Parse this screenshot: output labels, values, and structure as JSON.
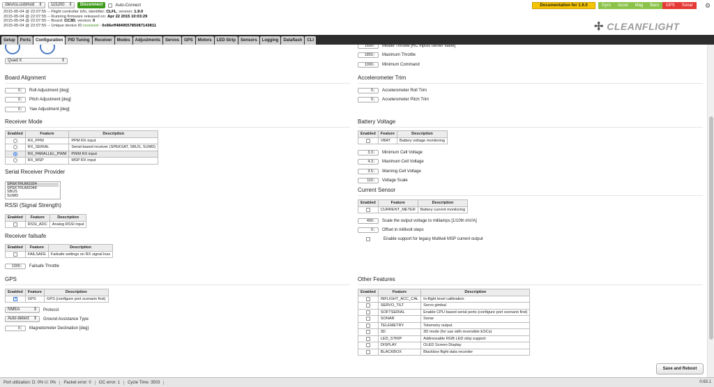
{
  "header": {
    "port": "/dev/cu.usbmod",
    "baud": "115200",
    "disconnect": "Disconnect",
    "autoconnect": "Auto-Connect",
    "documentation": "Documentation for 1.9.0",
    "sensors": [
      {
        "label": "Gyro",
        "color": "#8bc34a"
      },
      {
        "label": "Accel",
        "color": "#8bc34a"
      },
      {
        "label": "Mag",
        "color": "#8bc34a"
      },
      {
        "label": "Baro",
        "color": "#8bc34a"
      },
      {
        "label": "GPS",
        "color": "#e53935"
      },
      {
        "label": "Sonar",
        "color": "#e53935"
      }
    ],
    "logo": "CLEANFLIGHT"
  },
  "log": [
    {
      "pre": "2015-05-04 @ 22:07:55 -- Flight controller info, identifier: ",
      "b": "CLFL",
      "post": ", version: ",
      "b2": "1.9.0"
    },
    {
      "pre": "2015-05-04 @ 22:07:55 -- Running firmware released on: ",
      "b": "Apr 22 2015 10:03:29",
      "post": "",
      "b2": ""
    },
    {
      "pre": "2015-05-04 @ 22:07:55 -- Board: ",
      "b": "CC3D",
      "post": ", version: ",
      "b2": "0"
    },
    {
      "pre": "2015-05-04 @ 22:07:55 -- Unique device ID ",
      "g": "received",
      "post": " - ",
      "b2": "0x66eff484955785087143811"
    }
  ],
  "tabs": [
    "Setup",
    "Ports",
    "Configuration",
    "PID Tuning",
    "Receiver",
    "Modes",
    "Adjustments",
    "Servos",
    "GPS",
    "Motors",
    "LED Strip",
    "Sensors",
    "Logging",
    "Dataflash",
    "CLI"
  ],
  "mixer": "Quad X",
  "motorLimits": [
    {
      "value": "1500",
      "label": "Middle Throttle [RC inputs center value]"
    },
    {
      "value": "1850",
      "label": "Maximum Throttle"
    },
    {
      "value": "1000",
      "label": "Minimum Command"
    }
  ],
  "boardAlignment": {
    "title": "Board Alignment",
    "items": [
      {
        "value": "0",
        "label": "Roll Adjustment [deg]"
      },
      {
        "value": "0",
        "label": "Pitch Adjustment [deg]"
      },
      {
        "value": "0",
        "label": "Yaw Adjustment [deg]"
      }
    ]
  },
  "accTrim": {
    "title": "Accelerometer Trim",
    "items": [
      {
        "value": "0",
        "label": "Accelerometer Roll Trim"
      },
      {
        "value": "0",
        "label": "Accelerometer Pitch Trim"
      }
    ]
  },
  "receiverMode": {
    "title": "Receiver Mode",
    "headers": [
      "Enabled",
      "Feature",
      "Description"
    ],
    "rows": [
      {
        "f": "RX_PPM",
        "d": "PPM RX input",
        "on": false
      },
      {
        "f": "RX_SERIAL",
        "d": "Serial-based receiver (SPEKSAT, SBUS, SUMD)",
        "on": false
      },
      {
        "f": "RX_PARALLEL_PWM",
        "d": "PWM RX input",
        "on": true
      },
      {
        "f": "RX_MSP",
        "d": "MSP RX input",
        "on": false
      }
    ]
  },
  "serialRx": {
    "title": "Serial Receiver Provider",
    "items": [
      "SPEKTRUM1024",
      "SPEKTRUM2048",
      "SBUS",
      "SUMD"
    ]
  },
  "rssi": {
    "title": "RSSI (Signal Strength)",
    "headers": [
      "Enabled",
      "Feature",
      "Description"
    ],
    "rows": [
      {
        "f": "RSSI_ADC",
        "d": "Analog RSSI input"
      }
    ]
  },
  "failsafe": {
    "title": "Receiver failsafe",
    "headers": [
      "Enabled",
      "Feature",
      "Description"
    ],
    "rows": [
      {
        "f": "FAILSAFE",
        "d": "Failsafe settings on RX signal loss"
      }
    ],
    "throttleValue": "1000",
    "throttleLabel": "Failsafe Throttle"
  },
  "battery": {
    "title": "Battery Voltage",
    "headers": [
      "Enabled",
      "Feature",
      "Description"
    ],
    "rows": [
      {
        "f": "VBAT",
        "d": "Battery voltage monitoring"
      }
    ],
    "items": [
      {
        "value": "3.3",
        "label": "Minimum Cell Voltage"
      },
      {
        "value": "4.3",
        "label": "Maximum Cell Voltage"
      },
      {
        "value": "3.5",
        "label": "Warning Cell Voltage"
      },
      {
        "value": "110",
        "label": "Voltage Scale"
      }
    ]
  },
  "current": {
    "title": "Current Sensor",
    "headers": [
      "Enabled",
      "Feature",
      "Description"
    ],
    "rows": [
      {
        "f": "CURRENT_METER",
        "d": "Battery current monitoring"
      }
    ],
    "items": [
      {
        "value": "400",
        "label": "Scale the output voltage to milliamps [1/10th mV/A]"
      },
      {
        "value": "0",
        "label": "Offset in millivolt steps"
      }
    ],
    "legacy": "Enable support for legacy Multiwii MSP current output"
  },
  "gps": {
    "title": "GPS",
    "headers": [
      "Enabled",
      "Feature",
      "Description"
    ],
    "rows": [
      {
        "f": "GPS",
        "d": "GPS (configure port scenario first)"
      }
    ],
    "protocol": "NMEA",
    "protocolLabel": "Protocol",
    "assist": "Auto-detect",
    "assistLabel": "Ground Assistance Type",
    "decl": "0",
    "declLabel": "Magnetometer Declination [deg]"
  },
  "other": {
    "title": "Other Features",
    "headers": [
      "Enabled",
      "Feature",
      "Description"
    ],
    "rows": [
      {
        "f": "INFLIGHT_ACC_CAL",
        "d": "In-flight level calibration"
      },
      {
        "f": "SERVO_TILT",
        "d": "Servo gimbal"
      },
      {
        "f": "SOFTSERIAL",
        "d": "Enable CPU based serial ports (configure port scenario first)"
      },
      {
        "f": "SONAR",
        "d": "Sonar"
      },
      {
        "f": "TELEMETRY",
        "d": "Telemetry output"
      },
      {
        "f": "3D",
        "d": "3D mode (for use with reversible ESCs)"
      },
      {
        "f": "LED_STRIP",
        "d": "Addressable RGB LED strip support"
      },
      {
        "f": "DISPLAY",
        "d": "OLED Screen Display"
      },
      {
        "f": "BLACKBOX",
        "d": "Blackbox flight data recorder"
      }
    ]
  },
  "save": "Save and Reboot",
  "footer": {
    "port": "Port utilization: D: 0% U: 0%",
    "packet": "Packet error: 0",
    "i2c": "I2C error: 1",
    "cycle": "Cycle Time: 3503",
    "version": "0.63.1"
  }
}
